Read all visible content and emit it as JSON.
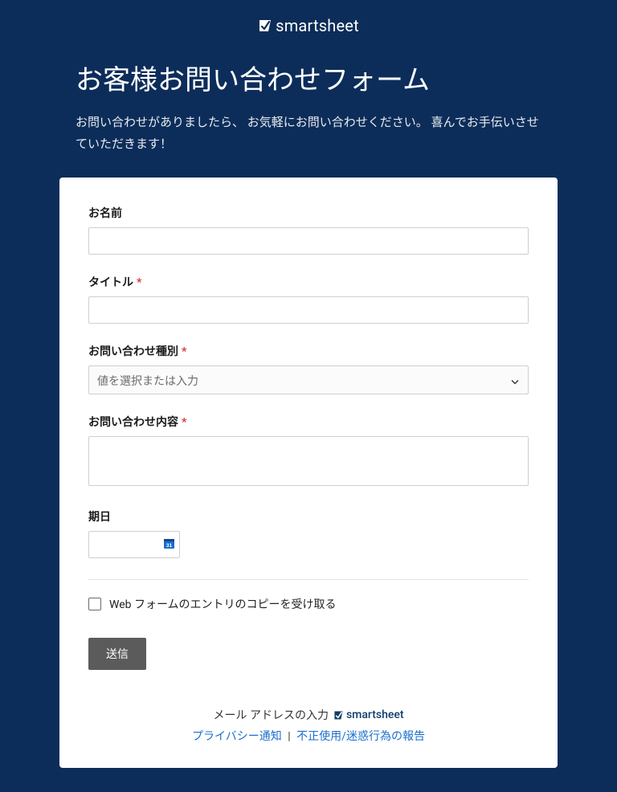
{
  "brand": {
    "name": "smartsheet"
  },
  "header": {
    "title": "お客様お問い合わせフォーム",
    "description": "お問い合わせがありましたら、 お気軽にお問い合わせください。 喜んでお手伝いさせていただきます！"
  },
  "form": {
    "name": {
      "label": "お名前",
      "value": ""
    },
    "title": {
      "label": "タイトル",
      "required": true,
      "value": ""
    },
    "type": {
      "label": "お問い合わせ種別",
      "required": true,
      "placeholder": "値を選択または入力"
    },
    "content": {
      "label": "お問い合わせ内容",
      "required": true,
      "value": ""
    },
    "deadline": {
      "label": "期日",
      "value": ""
    },
    "copy_checkbox": {
      "label": "Web フォームのエントリのコピーを受け取る",
      "checked": false
    },
    "submit": {
      "label": "送信"
    },
    "required_marker": "*"
  },
  "footer": {
    "email_label": "メール アドレスの入力",
    "brand": "smartsheet",
    "privacy": "プライバシー通知",
    "separator": "|",
    "report": "不正使用/迷惑行為の報告"
  }
}
